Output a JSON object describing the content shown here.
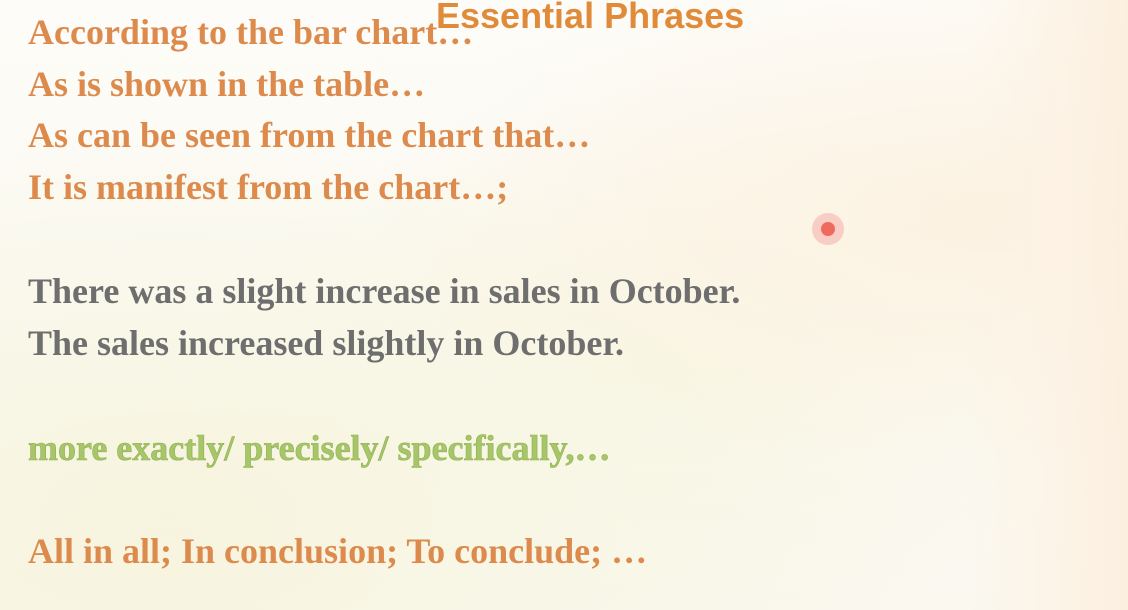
{
  "slide": {
    "title": "Essential Phrases",
    "chart_phrases": [
      "According to the bar chart…",
      "As is shown in the table…",
      "As can be seen from the chart that…",
      "It is manifest from the chart…;"
    ],
    "examples": [
      "There was a slight increase in sales in October.",
      "The sales increased slightly in October."
    ],
    "precision_phrase": "more exactly/ precisely/ specifically,…",
    "conclusion_phrase": "All in all; In conclusion; To conclude; …"
  },
  "colors": {
    "title": "#e08b3a",
    "phrase_orange": "#dd8a4d",
    "example_gray": "#6e6e6e",
    "precision_green": "#a7c66a",
    "pointer_red": "#ee6a5e"
  },
  "pointer": {
    "icon": "laser-pointer-icon"
  }
}
